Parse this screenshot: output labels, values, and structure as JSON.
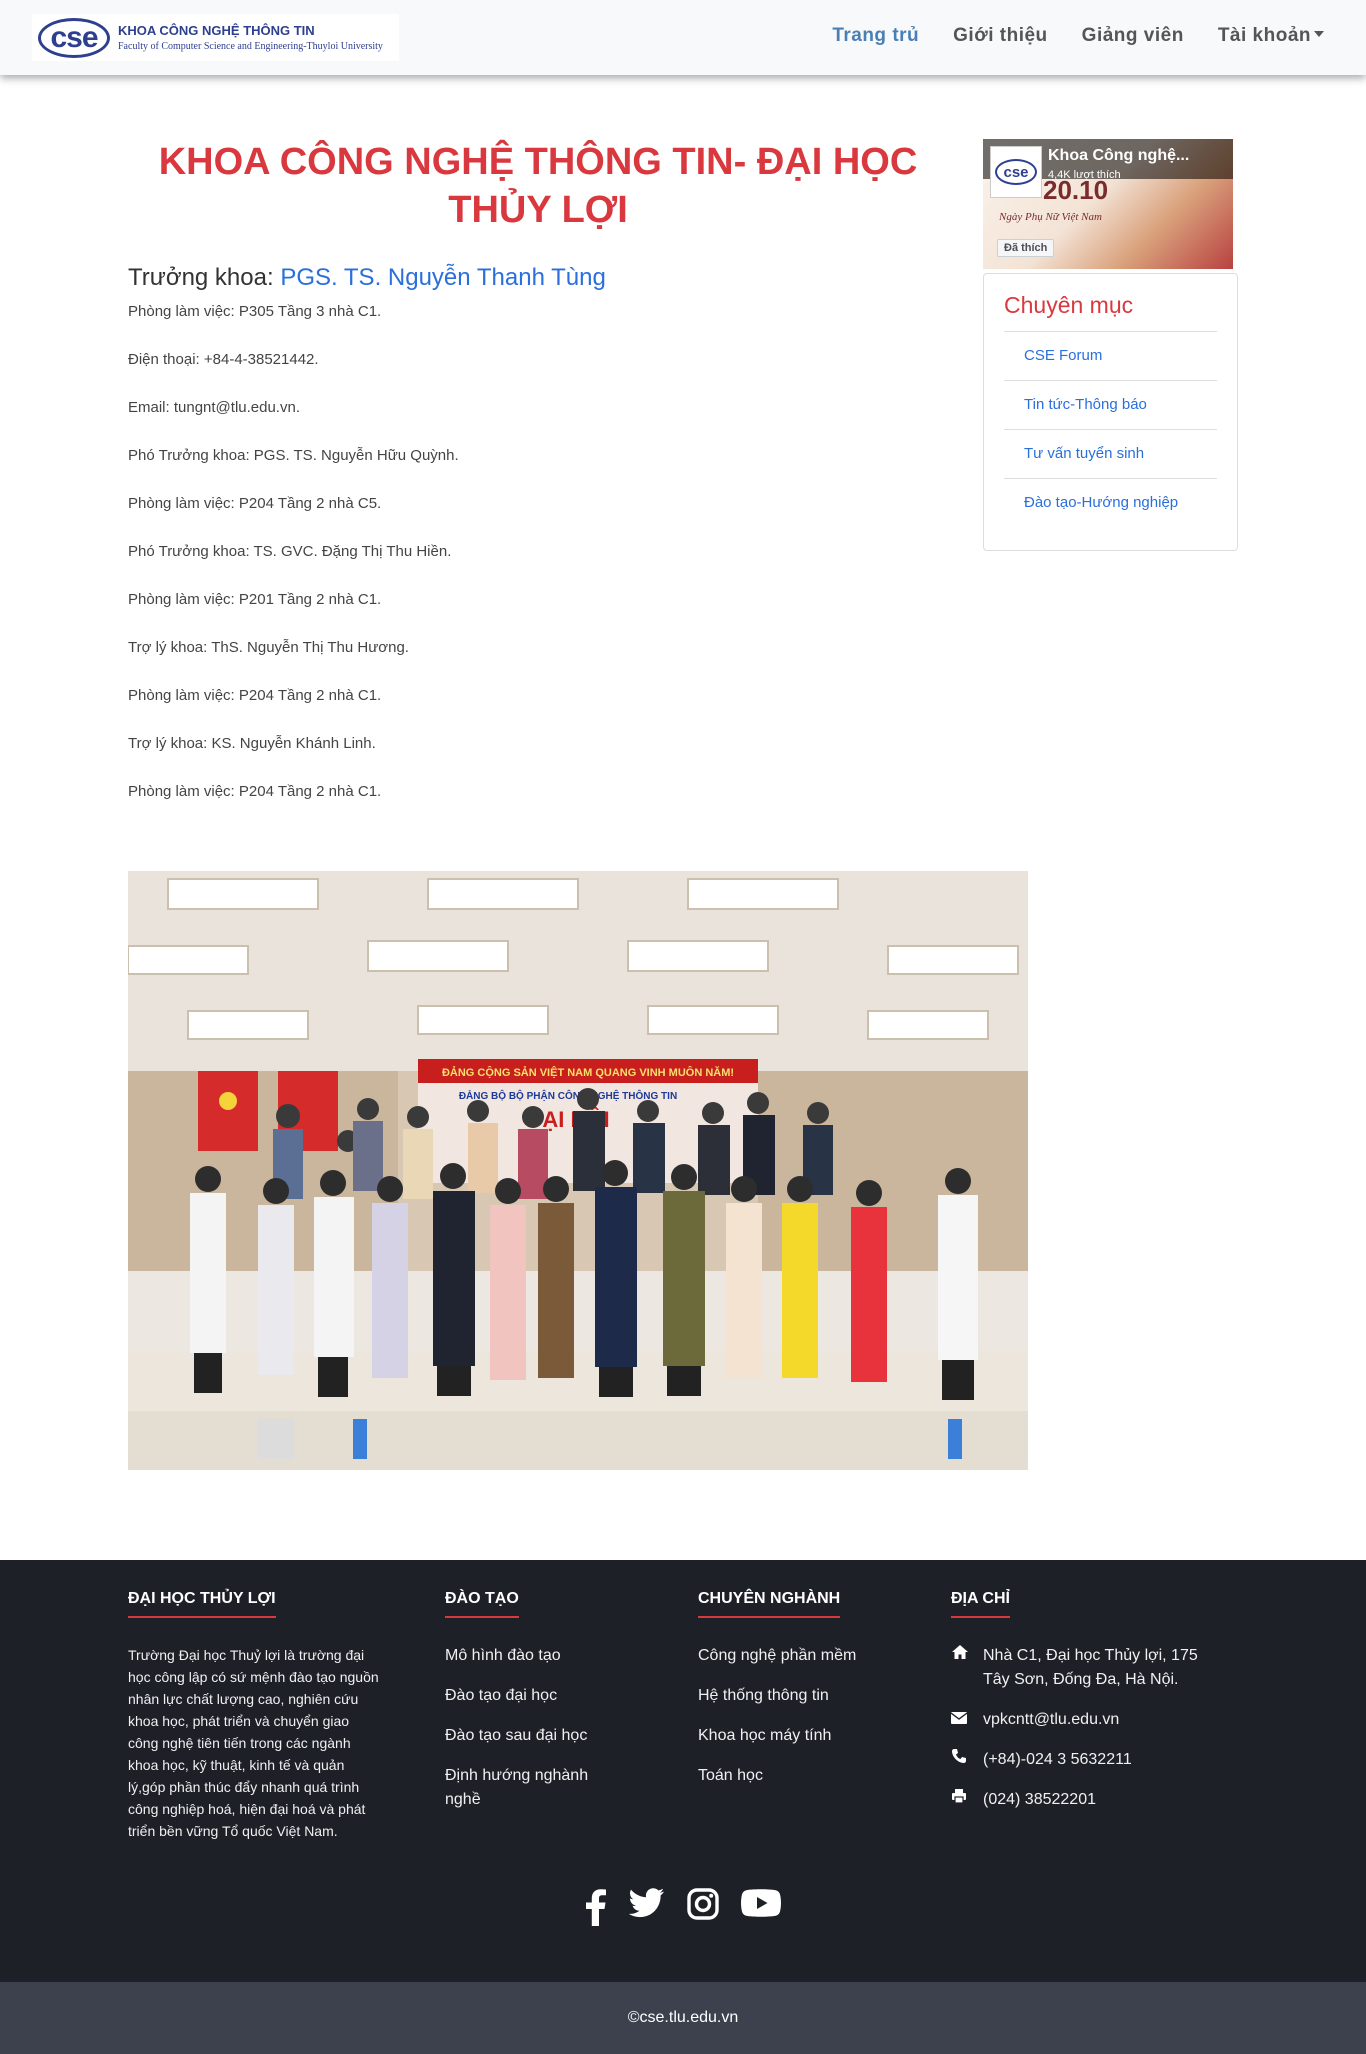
{
  "brand": {
    "mark": "cse",
    "title": "KHOA CÔNG NGHỆ THÔNG TIN",
    "subtitle": "Faculty of Computer Science and Engineering-Thuyloi University"
  },
  "nav": {
    "items": [
      {
        "label": "Trang trủ",
        "active": true
      },
      {
        "label": "Giới thiệu",
        "active": false
      },
      {
        "label": "Giảng viên",
        "active": false
      },
      {
        "label": "Tài khoản",
        "active": false,
        "dropdown": true
      }
    ]
  },
  "main": {
    "title_line1": "KHOA CÔNG NGHỆ THÔNG TIN- ĐẠI HỌC",
    "title_line2": "THỦY LỢI",
    "dean_prefix": "Trưởng khoa: ",
    "dean_name": "PGS. TS. Nguyễn Thanh Tùng",
    "info": [
      "Phòng làm việc: P305 Tầng 3 nhà C1.",
      "Điện thoại: +84-4-38521442.",
      "Email: tungnt@tlu.edu.vn.",
      "Phó Trưởng khoa: PGS. TS. Nguyễn Hữu Quỳnh.",
      "Phòng làm việc: P204 Tầng 2 nhà C5.",
      "Phó Trưởng khoa: TS. GVC. Đặng Thị Thu Hiền.",
      "Phòng làm việc: P201 Tầng 2 nhà C1.",
      "Trợ lý khoa: ThS. Nguyễn Thị Thu Hương.",
      "Phòng làm việc: P204 Tầng 2 nhà C1.",
      "Trợ lý khoa: KS. Nguyễn Khánh Linh.",
      "Phòng làm việc: P204 Tầng 2 nhà C1."
    ],
    "photo_banner": "ĐẢNG CỘNG SẢN VIỆT NAM QUANG VINH MUÔN NĂM!",
    "photo_banner2": "ĐẢNG BỘ BỘ PHẬN CÔNG NGHỆ THÔNG TIN",
    "photo_banner3": "ĐẠI HỘI"
  },
  "facebook": {
    "name": "Khoa Công nghệ...",
    "likes": "4,4K lượt thích",
    "date": "20.10",
    "promo": "Ngày Phụ Nữ Việt Nam",
    "like_button": "Đã thích"
  },
  "categories": {
    "title": "Chuyên mục",
    "items": [
      "CSE Forum",
      "Tin tức-Thông báo",
      "Tư vấn tuyển sinh",
      "Đào tạo-Hướng nghiệp"
    ]
  },
  "footer": {
    "about": {
      "heading": "ĐẠI HỌC THỦY LỢI",
      "text": "Trường Đại học Thuỷ lợi là trường đại học công lập có sứ mệnh đào tạo nguồn nhân lực chất lượng cao, nghiên cứu khoa học, phát triển và chuyển giao công nghệ tiên tiến trong các ngành khoa học, kỹ thuật, kinh tế và quản lý,góp phần thúc đẩy nhanh quá trình công nghiệp hoá, hiện đại hoá và phát triển bền vững Tổ quốc Việt Nam."
    },
    "training": {
      "heading": "ĐÀO TẠO",
      "items": [
        "Mô hình đào tạo",
        "Đào tạo đại học",
        "Đào tạo sau đại học",
        "Định hướng nghành nghề"
      ]
    },
    "majors": {
      "heading": "CHUYÊN NGHÀNH",
      "items": [
        "Công nghệ phần mềm",
        "Hệ thống thông tin",
        "Khoa học máy tính",
        "Toán học"
      ]
    },
    "address": {
      "heading": "ĐỊA CHỈ",
      "location": "Nhà C1, Đại học Thủy lợi, 175 Tây Sơn, Đống Đa, Hà Nội.",
      "email": "vpkcntt@tlu.edu.vn",
      "phone": "(+84)-024 3 5632211",
      "fax": "(024) 38522201"
    },
    "social": [
      "facebook-icon",
      "twitter-icon",
      "instagram-icon",
      "youtube-icon"
    ],
    "copyright": "©cse.tlu.edu.vn"
  }
}
